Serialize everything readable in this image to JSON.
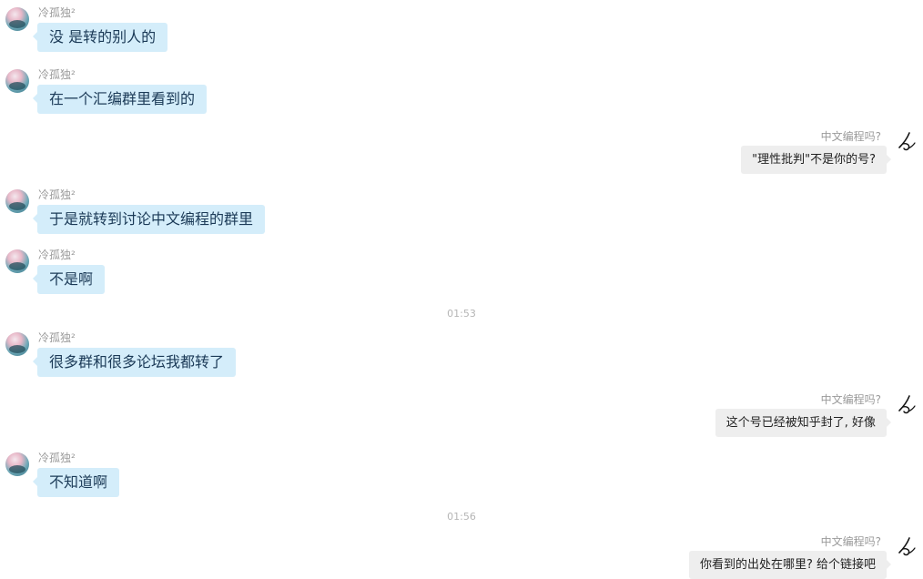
{
  "contact_name": "冷孤独²",
  "self_name": "中文编程吗?",
  "icons": {
    "contact_avatar": "avatar-photo-icon",
    "self_avatar": "brush-stroke-icon"
  },
  "colors": {
    "incoming_bubble": "#d4edfa",
    "incoming_text": "#1b3a57",
    "outgoing_bubble": "#eeeeee",
    "outgoing_text": "#222222",
    "timestamp_text": "#b5b5b5",
    "name_text": "#9a9a9a"
  },
  "messages": [
    {
      "side": "left",
      "sender": "冷孤独²",
      "text": "没 是转的别人的"
    },
    {
      "side": "left",
      "sender": "冷孤独²",
      "text": "在一个汇编群里看到的"
    },
    {
      "side": "right",
      "sender": "中文编程吗?",
      "text": "\"理性批判\"不是你的号?"
    },
    {
      "side": "left",
      "sender": "冷孤独²",
      "text": "于是就转到讨论中文编程的群里"
    },
    {
      "side": "left",
      "sender": "冷孤独²",
      "text": "不是啊"
    },
    {
      "type": "time",
      "text": "01:53"
    },
    {
      "side": "left",
      "sender": "冷孤独²",
      "text": "很多群和很多论坛我都转了"
    },
    {
      "side": "right",
      "sender": "中文编程吗?",
      "text": "这个号已经被知乎封了, 好像"
    },
    {
      "side": "left",
      "sender": "冷孤独²",
      "text": "不知道啊"
    },
    {
      "type": "time",
      "text": "01:56"
    },
    {
      "side": "right",
      "sender": "中文编程吗?",
      "text": "你看到的出处在哪里? 给个链接吧"
    }
  ]
}
